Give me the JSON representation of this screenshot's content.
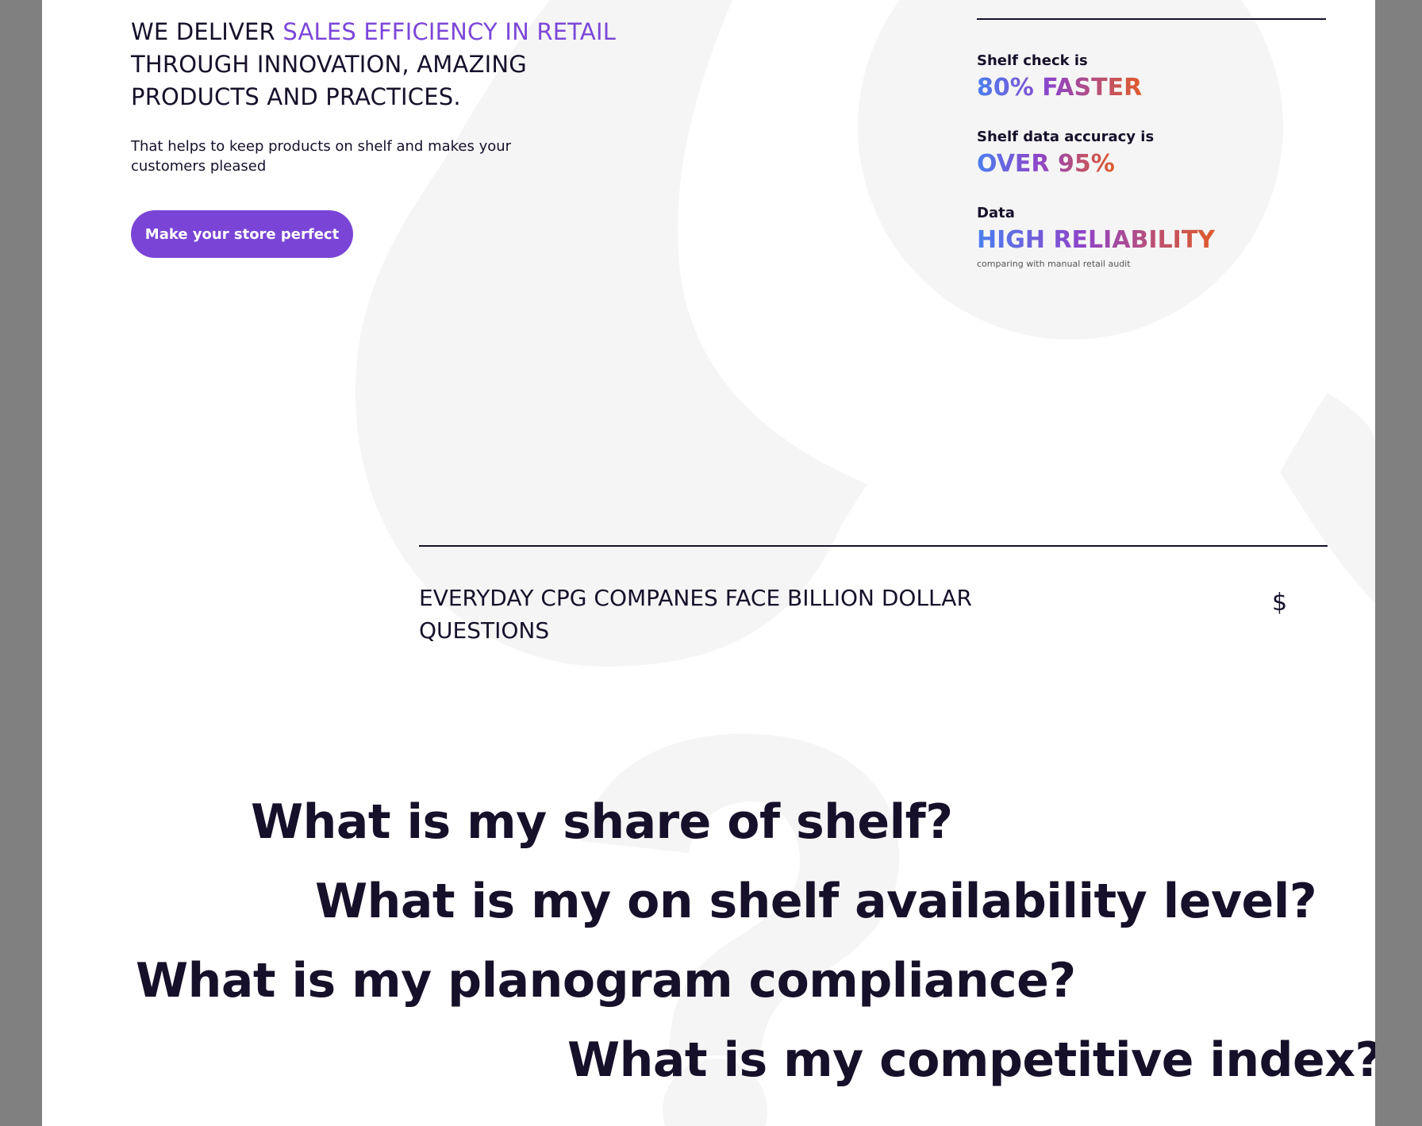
{
  "hero": {
    "heading_prefix": "WE DELIVER ",
    "heading_accent": "SALES EFFICIENCY IN RETAIL",
    "heading_rest": "THROUGH INNOVATION, AMAZING PRODUCTS AND PRACTICES.",
    "subtext": "That helps to keep products on shelf and makes your customers pleased",
    "cta_label": "Make your store perfect"
  },
  "stats": [
    {
      "label": "Shelf check is",
      "value": "80% FASTER"
    },
    {
      "label": "Shelf data accuracy is",
      "value": "OVER 95%"
    },
    {
      "label": "Data",
      "value": "HIGH RELIABILITY",
      "note": "comparing with manual retail audit"
    }
  ],
  "questions_section": {
    "heading": "EVERYDAY CPG COMPANES FACE BILLION DOLLAR QUESTIONS",
    "icon": "dollar-icon",
    "icon_glyph": "$",
    "questions": [
      "What is my share of shelf?",
      "What is my on shelf availability level?",
      "What is my planogram compliance?",
      "What is my competitive index?"
    ]
  },
  "colors": {
    "accent": "#7c47d8",
    "text": "#17102a",
    "gradient_start": "#4a7ff0",
    "gradient_end": "#e05a2a",
    "shape_fill": "#f5f5f5",
    "outer_background": "#808080"
  }
}
